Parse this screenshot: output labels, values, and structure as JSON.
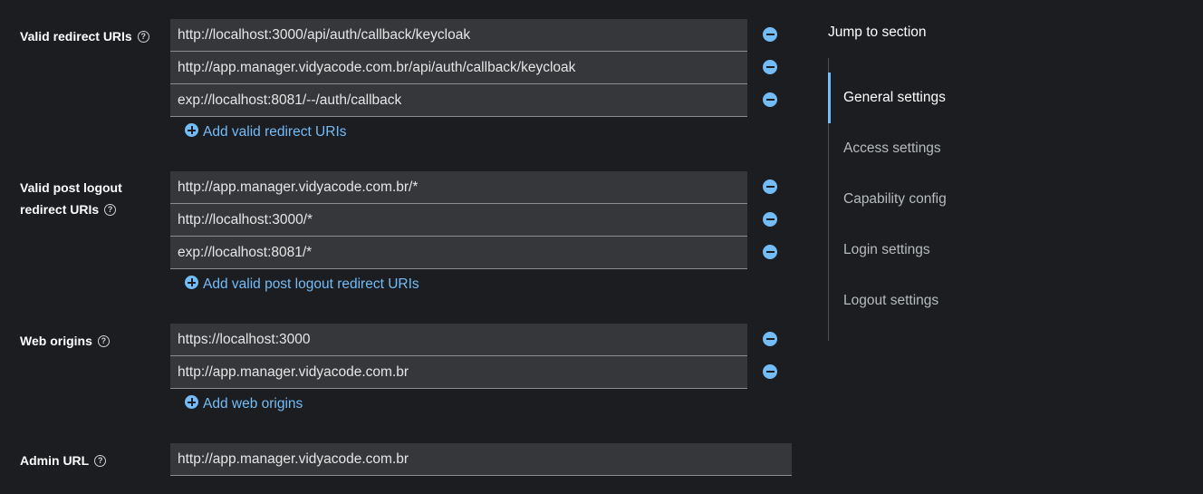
{
  "form": {
    "redirect_uris": {
      "label": "Valid redirect URIs",
      "values": [
        "http://localhost:3000/api/auth/callback/keycloak",
        "http://app.manager.vidyacode.com.br/api/auth/callback/keycloak",
        "exp://localhost:8081/--/auth/callback"
      ],
      "add_label": "Add valid redirect URIs"
    },
    "post_logout": {
      "label_line1": "Valid post logout",
      "label_line2": "redirect URIs",
      "values": [
        "http://app.manager.vidyacode.com.br/*",
        "http://localhost:3000/*",
        "exp://localhost:8081/*"
      ],
      "add_label": "Add valid post logout redirect URIs"
    },
    "web_origins": {
      "label": "Web origins",
      "values": [
        "https://localhost:3000",
        "http://app.manager.vidyacode.com.br"
      ],
      "add_label": "Add web origins"
    },
    "admin_url": {
      "label": "Admin URL",
      "value": "http://app.manager.vidyacode.com.br"
    },
    "help_glyph": "?"
  },
  "jump": {
    "title": "Jump to section",
    "items": [
      {
        "label": "General settings",
        "active": true
      },
      {
        "label": "Access settings",
        "active": false
      },
      {
        "label": "Capability config",
        "active": false
      },
      {
        "label": "Login settings",
        "active": false
      },
      {
        "label": "Logout settings",
        "active": false
      }
    ]
  },
  "colors": {
    "background": "#1b1d21",
    "field": "#36373b",
    "accent": "#73bcf7"
  }
}
